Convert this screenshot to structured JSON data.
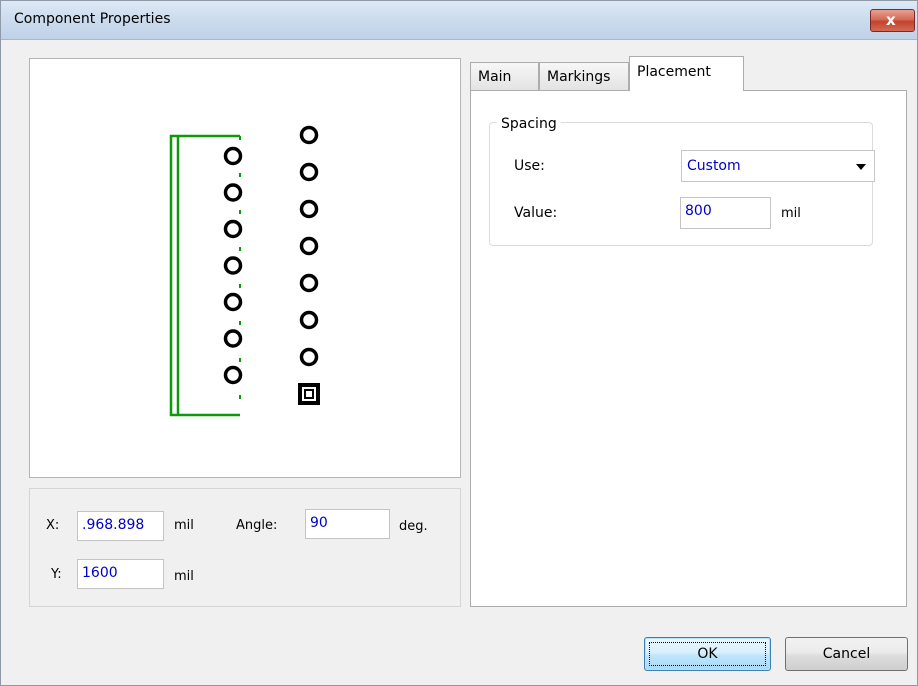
{
  "window": {
    "title": "Component Properties",
    "close_glyph": "x"
  },
  "preview": {
    "outline_color": "#0a9a0a",
    "pin_color": "#000000",
    "left_column_pins": 7,
    "right_column_pins": 8
  },
  "coords": {
    "x_label": "X:",
    "x_value": ".968.898",
    "x_unit": "mil",
    "y_label": "Y:",
    "y_value": "1600",
    "y_unit": "mil",
    "angle_label": "Angle:",
    "angle_value": "90",
    "angle_unit": "deg."
  },
  "tabs": [
    {
      "label": "Main",
      "active": false
    },
    {
      "label": "Markings",
      "active": false
    },
    {
      "label": "Placement",
      "active": true
    }
  ],
  "placement": {
    "group_title": "Spacing",
    "use_label": "Use:",
    "use_value": "Custom",
    "value_label": "Value:",
    "value_value": "800",
    "value_unit": "mil"
  },
  "buttons": {
    "ok": "OK",
    "cancel": "Cancel"
  }
}
